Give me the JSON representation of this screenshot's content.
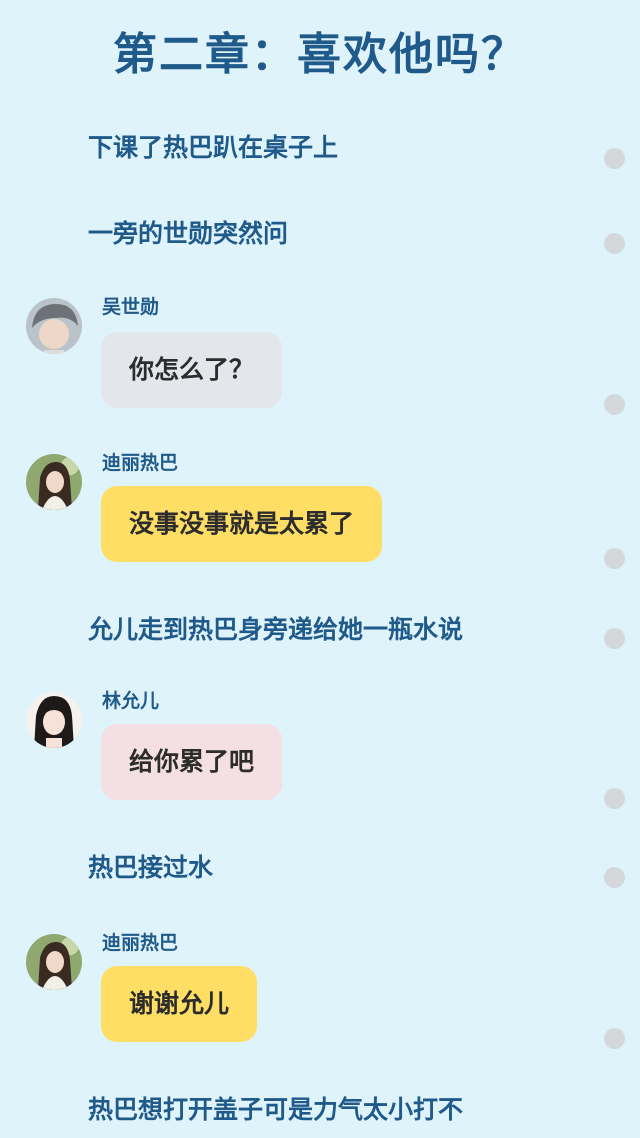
{
  "title": "第二章：喜欢他吗？",
  "lines": [
    {
      "text": "下课了热巴趴在桌子上"
    },
    {
      "text": "一旁的世勋突然问"
    },
    {
      "speaker": "吴世勋",
      "text": "你怎么了？",
      "bubble_color": "#e3e7ec",
      "avatar": "male-avatar-gray-hair"
    },
    {
      "speaker": "迪丽热巴",
      "text": "没事没事就是太累了",
      "bubble_color": "#ffde66",
      "avatar": "female-avatar-long-hair"
    },
    {
      "text": "允儿走到热巴身旁递给她一瓶水说"
    },
    {
      "speaker": "林允儿",
      "text": "给你累了吧",
      "bubble_color": "#f4dfe2",
      "avatar": "female-avatar-bangs"
    },
    {
      "text": "热巴接过水"
    },
    {
      "speaker": "迪丽热巴",
      "text": "谢谢允儿",
      "bubble_color": "#ffde66",
      "avatar": "female-avatar-long-hair"
    },
    {
      "text": "热巴想打开盖子可是力气太小打不"
    }
  ],
  "colors": {
    "background": "#dff3fb",
    "narration_text": "#1f5a8a",
    "scroll_dot": "#d4d8db"
  }
}
